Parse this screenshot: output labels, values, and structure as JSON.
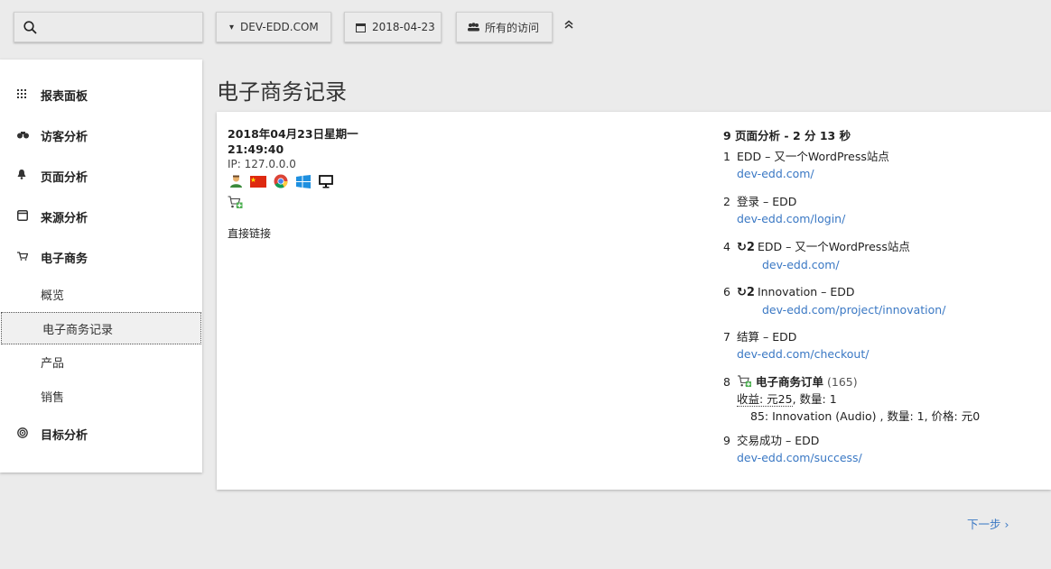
{
  "topbar": {
    "search_placeholder": "",
    "site": "DEV-EDD.COM",
    "date": "2018-04-23",
    "segment": "所有的访问"
  },
  "sidebar": {
    "items": [
      {
        "label": "报表面板",
        "icon": "grid-icon"
      },
      {
        "label": "访客分析",
        "icon": "binoculars-icon"
      },
      {
        "label": "页面分析",
        "icon": "bell-icon"
      },
      {
        "label": "来源分析",
        "icon": "window-icon"
      },
      {
        "label": "电子商务",
        "icon": "cart-icon"
      }
    ],
    "ecommerce_sub": [
      "概览",
      "电子商务记录",
      "产品",
      "销售"
    ],
    "goals": {
      "label": "目标分析",
      "icon": "target-icon"
    }
  },
  "page": {
    "title": "电子商务记录"
  },
  "visit": {
    "date_line": "2018年04月23日星期一",
    "time": "21:49:40",
    "ip": "IP: 127.0.0.0",
    "referrer": "直接链接"
  },
  "actions": {
    "header": "9 页面分析 - 2 分 13 秒",
    "items": [
      {
        "num": "1",
        "title": "EDD – 又一个WordPress站点",
        "url": "dev-edd.com/"
      },
      {
        "num": "2",
        "title": "登录 – EDD",
        "url": "dev-edd.com/login/"
      },
      {
        "num": "4",
        "reload": "2",
        "title": "EDD – 又一个WordPress站点",
        "url": "dev-edd.com/"
      },
      {
        "num": "6",
        "reload": "2",
        "title": "Innovation – EDD",
        "url": "dev-edd.com/project/innovation/"
      },
      {
        "num": "7",
        "title": "结算 – EDD",
        "url": "dev-edd.com/checkout/"
      },
      {
        "num": "8",
        "title": "电子商务订单",
        "order_id": "(165)",
        "revenue_label": "收益: 元25",
        "qty": ", 数量: 1",
        "line": "85: Innovation (Audio) , 数量: 1, 价格: 元0"
      },
      {
        "num": "9",
        "title": "交易成功 – EDD",
        "url": "dev-edd.com/success/"
      }
    ]
  },
  "pagination": {
    "next": "下一步 ›"
  }
}
